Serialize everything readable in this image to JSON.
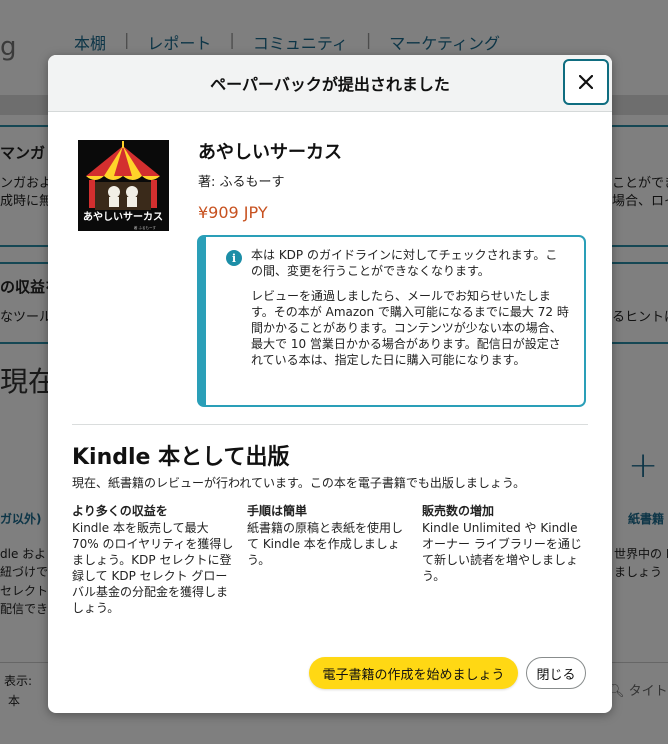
{
  "background": {
    "logo_fragment": "g",
    "nav": [
      "本棚",
      "レポート",
      "コミュニティ",
      "マーケティング"
    ],
    "fragments": {
      "manga_heading": "マンガ",
      "manga_line1": "ンガおよ",
      "manga_line2": "成時に無",
      "right_line1": "ことができ",
      "right_line2": "場合、ロイ",
      "profit_heading": "の収益を",
      "tools_line": "なツール",
      "hint_line": "るヒントは",
      "big_heading": "現在",
      "left_link": "ガ以外)",
      "right_link": "紙書籍",
      "left_p1": "dle およ",
      "left_p2": "紐づけで",
      "left_p3": "セレクト",
      "left_p4": "配信でき",
      "right_p1": "世界中の K",
      "right_p2": "ましょう",
      "display_label": "表示:",
      "display_value": "本",
      "search_placeholder": "タイトル"
    }
  },
  "modal": {
    "title": "ペーパーバックが提出されました",
    "close_icon": "close-icon",
    "book": {
      "title": "あやしいサーカス",
      "author": "著: ふるもーす",
      "price": "¥909 JPY",
      "cover_title": "あやしいサーカス",
      "cover_credit": "著 ふるもーす"
    },
    "info": {
      "icon": "info-icon",
      "paragraph1": "本は KDP のガイドラインに対してチェックされます。この間、変更を行うことができなくなります。",
      "paragraph2": "レビューを通過しましたら、メールでお知らせいたします。その本が Amazon で購入可能になるまでに最大 72 時間かかることがあります。コンテンツが少ない本の場合、最大で 10 営業日かかる場合があります。配信日が設定されている本は、指定した日に購入可能になります。"
    },
    "kindle": {
      "heading": "Kindle 本として出版",
      "description": "現在、紙書籍のレビューが行われています。この本を電子書籍でも出版しましょう。",
      "benefits": [
        {
          "title": "より多くの収益を",
          "text": "Kindle 本を販売して最大 70% のロイヤリティを獲得しましょう。KDP セレクトに登録して KDP セレクト グローバル基金の分配金を獲得しましょう。"
        },
        {
          "title": "手順は簡単",
          "text": "紙書籍の原稿と表紙を使用して Kindle 本を作成しましょう。"
        },
        {
          "title": "販売数の増加",
          "text": "Kindle Unlimited や Kindle オーナー ライブラリーを通じて新しい読者を増やしましょう。"
        }
      ]
    },
    "buttons": {
      "primary": "電子書籍の作成を始めましょう",
      "close": "閉じる"
    }
  },
  "colors": {
    "accent": "#2a9fb8",
    "price": "#c7511f",
    "primary_button": "#ffd814"
  }
}
